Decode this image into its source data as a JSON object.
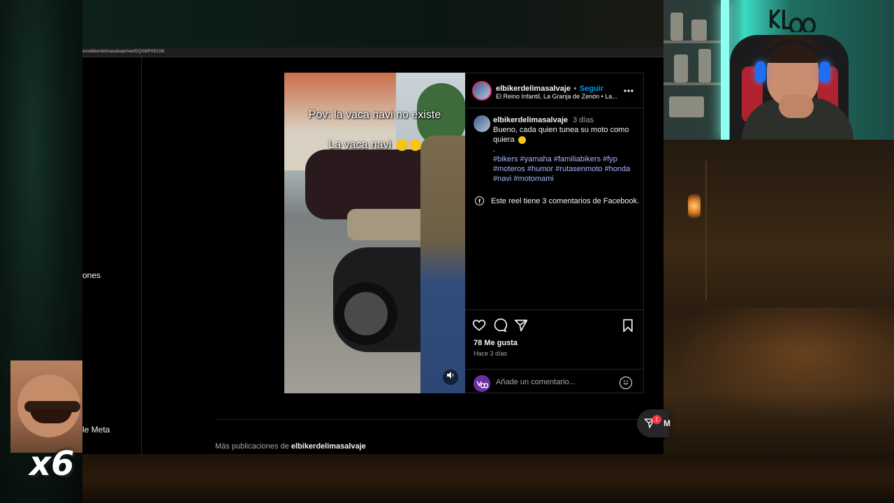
{
  "browser": {
    "url": "es/elbikerdelimasalvaje/reel/DQXt6PHD156/"
  },
  "sidenav": {
    "partial_item_1": "ones",
    "partial_item_2": "le Meta"
  },
  "video": {
    "caption_line1": "Pov: la vaca navi no existe",
    "caption_line2": "La vaca navi"
  },
  "post": {
    "username": "elbikerdelimasalvaje",
    "separator": "•",
    "follow_label": "Seguir",
    "location": "El Reino Infantil, La Granja de Zenón • La...",
    "caption_username": "elbikerdelimasalvaje",
    "caption_age": "3 días",
    "caption_text": "Bueno, cada quien tunea su moto como quiera",
    "caption_dot": ".",
    "hashtags_line1": "#bikers #yamaha #familiabikers #fyp",
    "hashtags_line2": "#moteros #humor #rutasenmoto #honda",
    "hashtags_line3": "#navi #motomami",
    "facebook_comments": "Este reel tiene 3 comentarios de Facebook.",
    "likes": "78 Me gusta",
    "posted_ago": "Hace 3 días",
    "comment_placeholder": "Añade un comentario...",
    "more_posts_prefix": "Más publicaciones de",
    "more_posts_user": "elbikerdelimasalvaje"
  },
  "messages": {
    "badge_count": "1",
    "label": "M"
  },
  "overlay": {
    "multiplier": "x6"
  },
  "icons": [
    "more-icon",
    "facebook-icon",
    "like-icon",
    "comment-icon",
    "share-icon",
    "save-icon",
    "emoji-icon",
    "volume-icon",
    "messages-icon"
  ]
}
